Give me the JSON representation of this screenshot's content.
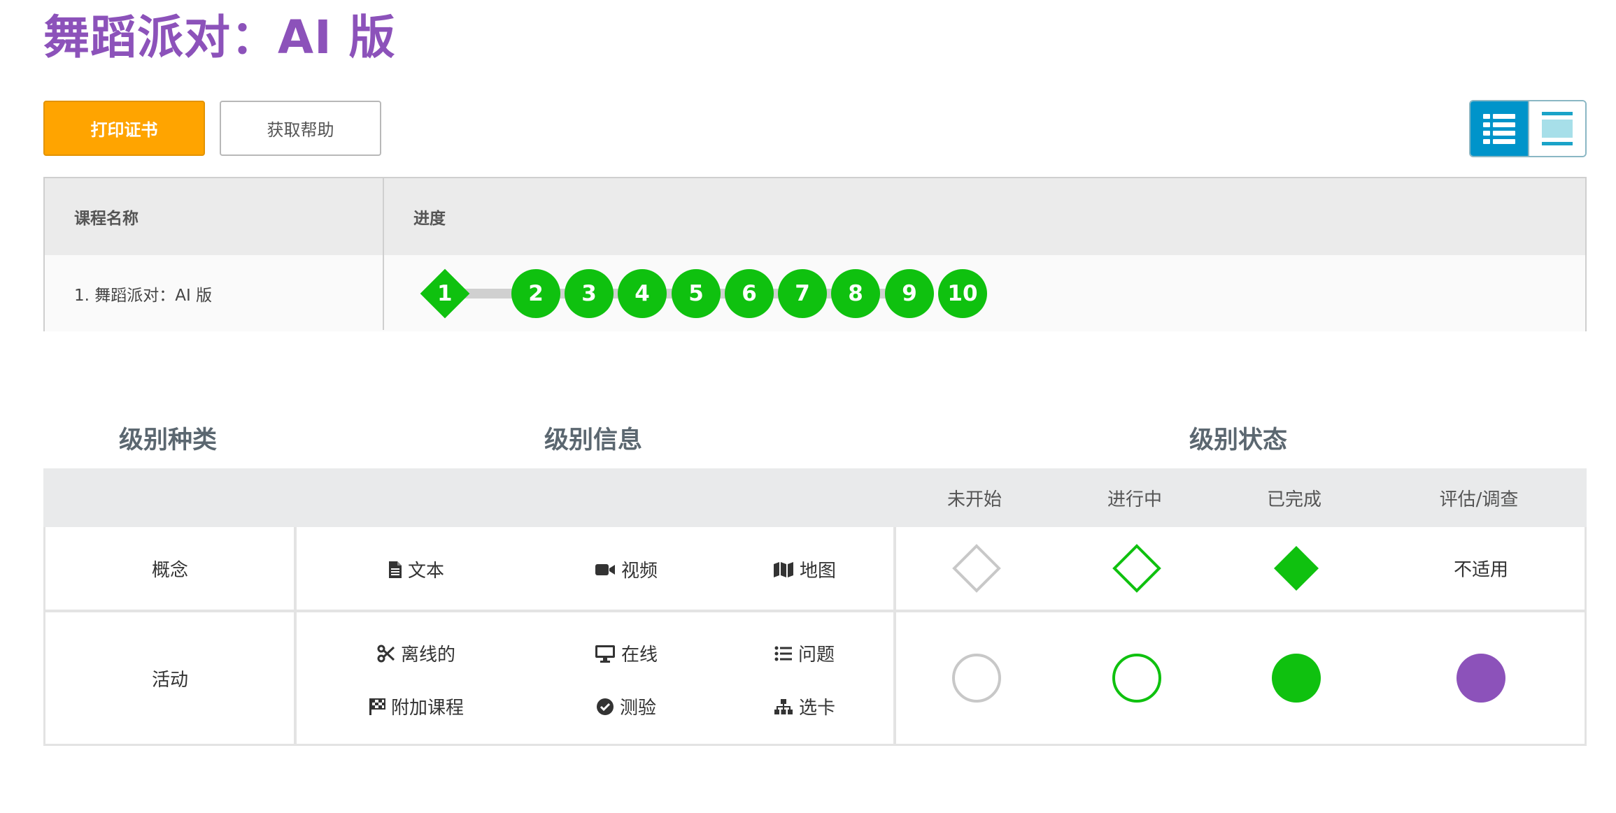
{
  "header": {
    "title": "舞蹈派对：AI 版"
  },
  "toolbar": {
    "print_label": "打印证书",
    "help_label": "获取帮助"
  },
  "progress_table": {
    "col_name": "课程名称",
    "col_progress": "进度",
    "course_name": "1. 舞蹈派对：AI 版",
    "levels": [
      "1",
      "2",
      "3",
      "4",
      "5",
      "6",
      "7",
      "8",
      "9",
      "10"
    ]
  },
  "legend": {
    "head_type": "级别种类",
    "head_info": "级别信息",
    "head_status": "级别状态",
    "status_cols": [
      "未开始",
      "进行中",
      "已完成",
      "评估/调查"
    ],
    "concept": {
      "label": "概念",
      "items": [
        "文本",
        "视频",
        "地图"
      ],
      "na": "不适用"
    },
    "activity": {
      "label": "活动",
      "items": [
        "离线的",
        "在线",
        "问题",
        "附加课程",
        "测验",
        "选卡"
      ]
    }
  },
  "colors": {
    "title": "#8c52ba",
    "print_button": "#ffa400",
    "completed": "#0fc10f",
    "assessment": "#8c52ba",
    "not_started": "#c8c8c8",
    "toggle_active": "#0094ca"
  }
}
